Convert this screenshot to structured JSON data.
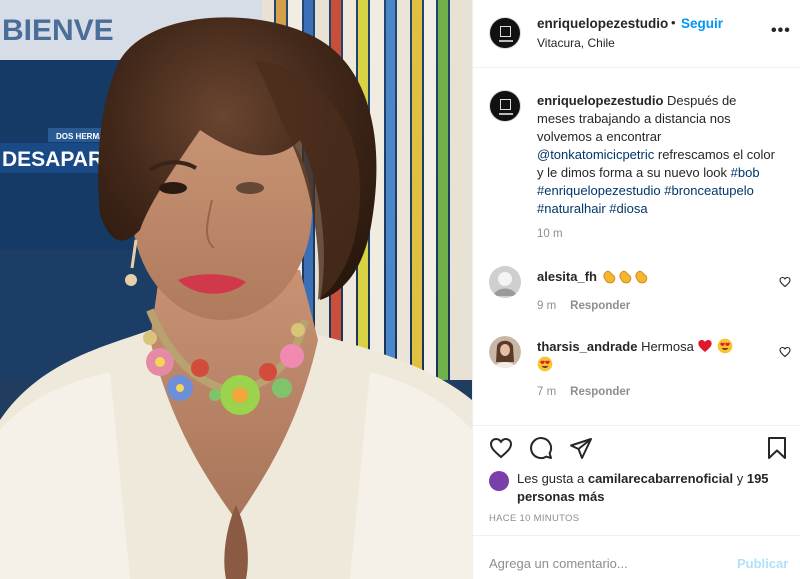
{
  "photo": {
    "alt": "",
    "bg_sign_top": "BIENVE",
    "bg_sign_banner": "DESAPARECIL",
    "bg_sign_small": "DOS HERMANAS"
  },
  "header": {
    "username": "enriquelopezestudio",
    "separator": "•",
    "follow_label": "Seguir",
    "location": "Vitacura, Chile",
    "more_label": "•••"
  },
  "caption": {
    "username": "enriquelopezestudio",
    "text_before": "Después de meses trabajando a distancia nos volvemos a encontrar",
    "mention": "@tonkatomicicpetric",
    "text_after": "refrescamos el color y le dimos forma a su nuevo look",
    "hashtags": [
      "#bob",
      "#enriquelopezestudio",
      "#bronceatupelo",
      "#naturalhair",
      "#diosa"
    ],
    "time": "10 m"
  },
  "comments": [
    {
      "username": "alesita_fh",
      "text": "",
      "emojis": [
        "clap",
        "clap",
        "clap"
      ],
      "time": "9 m",
      "reply_label": "Responder"
    },
    {
      "username": "tharsis_andrade",
      "text": "Hermosa",
      "emojis": [
        "heart",
        "heart-eyes",
        "heart-eyes"
      ],
      "time": "7 m",
      "reply_label": "Responder"
    }
  ],
  "likes": {
    "prefix": "Les gusta a",
    "username": "camilarecabarrenoficial",
    "joiner": "y",
    "others": "195 personas más"
  },
  "posted_ago": "HACE 10 MINUTOS",
  "add_comment": {
    "placeholder": "Agrega un comentario...",
    "publish_label": "Publicar"
  },
  "colors": {
    "link_blue": "#0095f6",
    "mention_blue": "#00376b",
    "muted_gray": "#8e8e8e",
    "publish_disabled": "#b2dffc"
  }
}
